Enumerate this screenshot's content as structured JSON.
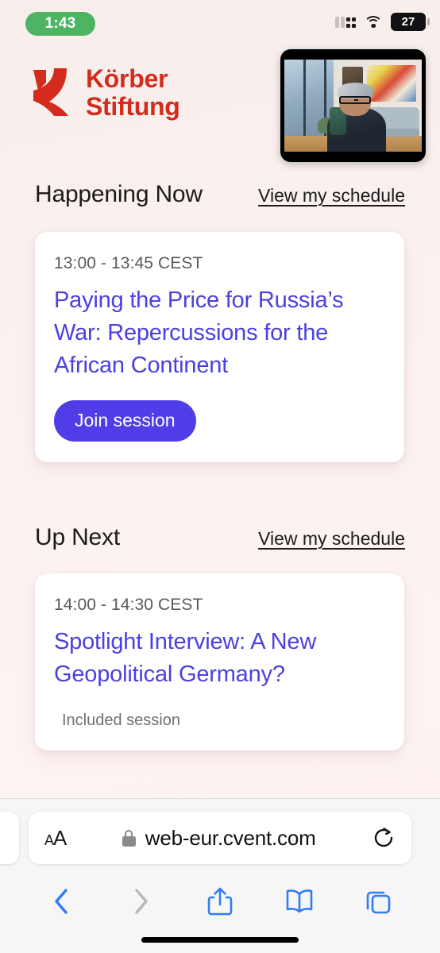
{
  "status_bar": {
    "time": "1:43",
    "time_pill_color": "#4cb462",
    "battery_percent": "27",
    "cellular_icon": "cellular-dots-icon",
    "wifi_icon": "wifi-icon",
    "battery_icon": "battery-icon"
  },
  "header": {
    "logo_line1": "Körber",
    "logo_line2": "Stiftung",
    "logo_color": "#d52b1e",
    "logo_mark_icon": "korber-k-mark-icon",
    "video_thumbnail": "self-view-video-thumbnail"
  },
  "sections": [
    {
      "title": "Happening Now",
      "schedule_link": "View my schedule",
      "card": {
        "time": "13:00 - 13:45 CEST",
        "title": "Paying the Price for Russia’s War: Repercussions for the African Continent",
        "button_label": "Join session",
        "button_color": "#4f3ee8",
        "note": ""
      }
    },
    {
      "title": "Up Next",
      "schedule_link": "View my schedule",
      "card": {
        "time": "14:00 - 14:30 CEST",
        "title": "Spotlight Interview: A New Geopolitical Germany?",
        "button_label": "",
        "note": "Included session"
      }
    }
  ],
  "browser": {
    "text_size_button": "AA",
    "lock_icon": "lock-icon",
    "url": "web-eur.cvent.com",
    "reload_icon": "reload-icon",
    "toolbar": {
      "back_icon": "back-chevron-icon",
      "forward_icon": "forward-chevron-icon",
      "share_icon": "share-icon",
      "bookmarks_icon": "book-icon",
      "tabs_icon": "tabs-icon"
    },
    "accent_color": "#2f7cf6",
    "disabled_color": "#b8b8bb"
  },
  "theme": {
    "page_background": "#fbf1ef",
    "card_background": "#ffffff",
    "link_color": "#4b40e0",
    "muted_text": "#575a5e"
  }
}
